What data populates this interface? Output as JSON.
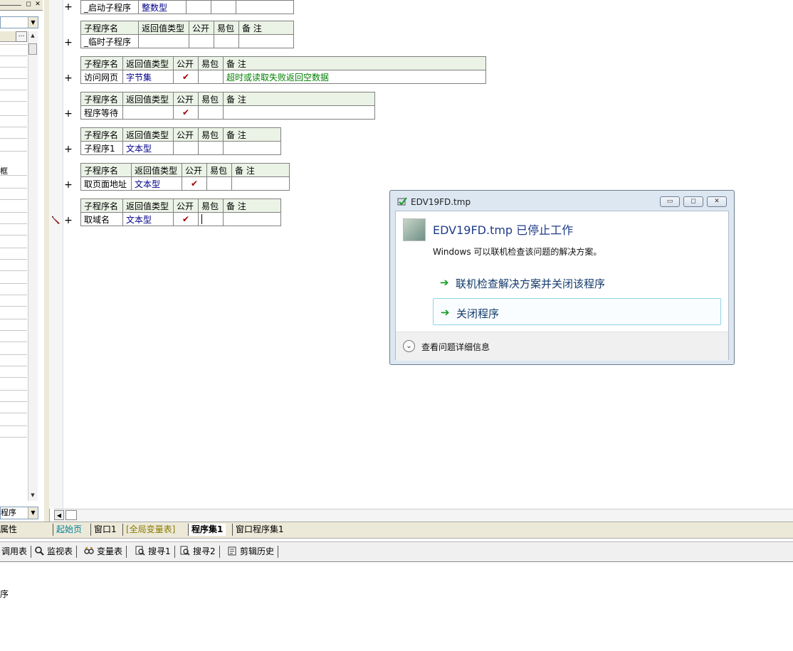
{
  "tables": [
    {
      "cols": [
        "_启动子程序",
        "整数型",
        "",
        "",
        ""
      ],
      "only_row": true
    },
    {
      "headers": [
        "子程序名",
        "返回值类型",
        "公开",
        "易包",
        "备 注"
      ],
      "row": [
        "_临时子程序",
        "",
        "",
        "",
        ""
      ]
    },
    {
      "headers": [
        "子程序名",
        "返回值类型",
        "公开",
        "易包",
        "备 注"
      ],
      "row": [
        "访问网页",
        "字节集",
        "✔",
        "",
        "超时或读取失败返回空数据"
      ]
    },
    {
      "headers": [
        "子程序名",
        "返回值类型",
        "公开",
        "易包",
        "备 注"
      ],
      "row": [
        "程序等待",
        "",
        "✔",
        "",
        ""
      ]
    },
    {
      "headers": [
        "子程序名",
        "返回值类型",
        "公开",
        "易包",
        "备 注"
      ],
      "row": [
        "子程序1",
        "文本型",
        "",
        "",
        ""
      ]
    },
    {
      "headers": [
        "子程序名",
        "返回值类型",
        "公开",
        "易包",
        "备 注"
      ],
      "row": [
        "取页面地址",
        "文本型",
        "✔",
        "",
        ""
      ]
    },
    {
      "headers": [
        "子程序名",
        "返回值类型",
        "公开",
        "易包",
        "备 注"
      ],
      "row": [
        "取域名",
        "文本型",
        "✔",
        "",
        ""
      ]
    }
  ],
  "plus_sign": "+",
  "left_panel": {
    "row_label_1": "框",
    "bottom_combo": "程序",
    "tab_label": "属性"
  },
  "tabs": [
    {
      "label": "起始页",
      "color": "#00809a"
    },
    {
      "label": "窗口1",
      "color": "#000000"
    },
    {
      "label": "[全局变量表]",
      "color": "#8a7a00"
    },
    {
      "label": "程序集1",
      "color": "#000000",
      "active": true
    },
    {
      "label": "窗口程序集1",
      "color": "#000000"
    }
  ],
  "bottom_tools": [
    {
      "label": "调用表",
      "icon": "call-table-icon"
    },
    {
      "label": "监视表",
      "icon": "magnifier-icon"
    },
    {
      "label": "变量表",
      "icon": "variable-icon"
    },
    {
      "label": "搜寻1",
      "icon": "search-list-icon"
    },
    {
      "label": "搜寻2",
      "icon": "search-list-icon"
    },
    {
      "label": "剪辑历史",
      "icon": "clipboard-icon"
    }
  ],
  "output_text": "序",
  "dialog": {
    "title": "EDV19FD.tmp",
    "heading": "EDV19FD.tmp 已停止工作",
    "subtext": "Windows 可以联机检查该问题的解决方案。",
    "option1": "联机检查解决方案并关闭该程序",
    "option2": "关闭程序",
    "details": "查看问题详细信息",
    "accent": "#1e3c8a"
  }
}
